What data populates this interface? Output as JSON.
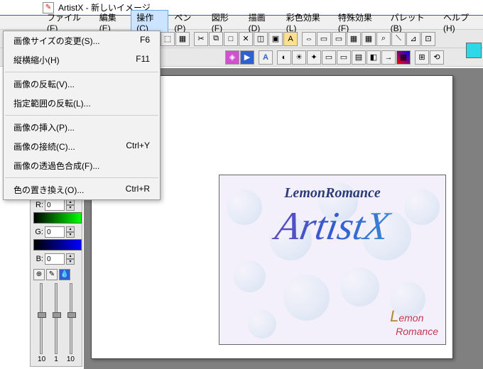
{
  "title": {
    "app": "ArtistX",
    "doc": "新しいイメージ"
  },
  "menubar": [
    {
      "label": "ファイル(F)"
    },
    {
      "label": "編集(E)"
    },
    {
      "label": "操作(C)",
      "active": true
    },
    {
      "label": "ペン(P)"
    },
    {
      "label": "図形(F)"
    },
    {
      "label": "描画(D)"
    },
    {
      "label": "彩色効果(L)"
    },
    {
      "label": "特殊効果(F)"
    },
    {
      "label": "パレット(B)"
    },
    {
      "label": "ヘルプ(H)"
    }
  ],
  "dropdown": [
    {
      "label": "画像サイズの変更(S)...",
      "accel": "F6"
    },
    {
      "label": "縦横縮小(H)",
      "accel": "F11"
    },
    {
      "sep": true
    },
    {
      "label": "画像の反転(V)..."
    },
    {
      "label": "指定範囲の反転(L)..."
    },
    {
      "sep": true
    },
    {
      "label": "画像の挿入(P)..."
    },
    {
      "label": "画像の接続(C)...",
      "accel": "Ctrl+Y"
    },
    {
      "label": "画像の透過色合成(F)..."
    },
    {
      "sep": true
    },
    {
      "label": "色の置き換え(O)...",
      "accel": "Ctrl+R"
    }
  ],
  "rgb": {
    "r_label": "R:",
    "g_label": "G:",
    "b_label": "B:",
    "r": "0",
    "g": "0",
    "b": "0"
  },
  "vslider_labels": [
    "10",
    "1",
    "10"
  ],
  "splash": {
    "subtitle": "LemonRomance",
    "big": "ArtistX",
    "brand1": "L",
    "brand2": "emon",
    "brand3": "Romance"
  },
  "icons": {
    "t1": [
      "⬚",
      "▦",
      "✂",
      "⧉",
      "□",
      "✕",
      "◫",
      "▣",
      "A"
    ],
    "t1b": [
      "⇔",
      "▭",
      "▭",
      "▦",
      "▦",
      "⌕",
      "⟍",
      "⊿",
      "⊡"
    ],
    "t2": [
      "◈",
      "▶",
      "",
      "A",
      "◐",
      "☀",
      "✦",
      "▭",
      "▭",
      "▤",
      "◧",
      "→",
      "▦",
      "",
      "⊞",
      "⟲"
    ]
  }
}
